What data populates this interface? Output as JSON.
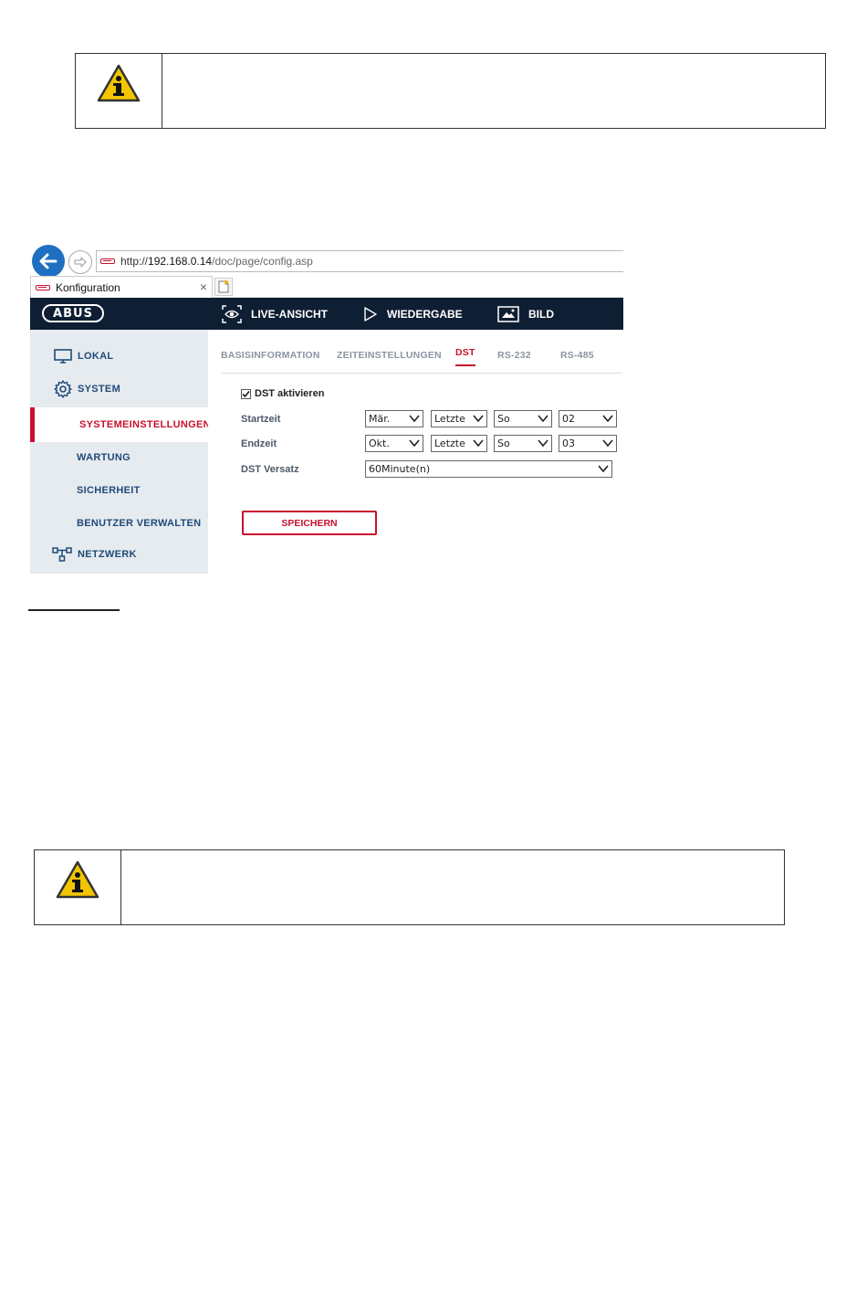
{
  "browser": {
    "address": {
      "scheme": "http://",
      "host": "192.168.0.14",
      "path": "/doc/page/config.asp"
    },
    "tab_title": "Konfiguration",
    "tab_close": "×"
  },
  "header": {
    "logo": "ABUS",
    "nav": [
      "LIVE-ANSICHT",
      "WIEDERGABE",
      "BILD"
    ]
  },
  "sidebar": {
    "items": [
      {
        "label": "LOKAL"
      },
      {
        "label": "SYSTEM"
      },
      {
        "label": "SYSTEMEINSTELLUNGEN"
      },
      {
        "label": "WARTUNG"
      },
      {
        "label": "SICHERHEIT"
      },
      {
        "label": "BENUTZER VERWALTEN"
      },
      {
        "label": "NETZWERK"
      }
    ]
  },
  "subtabs": [
    "BASISINFORMATION",
    "ZEITEINSTELLUNGEN",
    "DST",
    "RS-232",
    "RS-485"
  ],
  "form": {
    "dst_enable_label": "DST aktivieren",
    "dst_enable_checked": true,
    "start_label": "Startzeit",
    "start": {
      "month": "Mär.",
      "week": "Letzte",
      "day": "So",
      "hour": "02"
    },
    "end_label": "Endzeit",
    "end": {
      "month": "Okt.",
      "week": "Letzte",
      "day": "So",
      "hour": "03"
    },
    "offset_label": "DST Versatz",
    "offset": "60Minute(n)",
    "save_label": "SPEICHERN"
  },
  "colors": {
    "navbar": "#0e1e33",
    "accent": "#c8102e",
    "sidebar_bg": "#e6ebf0",
    "link_blue": "#1f4a78"
  }
}
